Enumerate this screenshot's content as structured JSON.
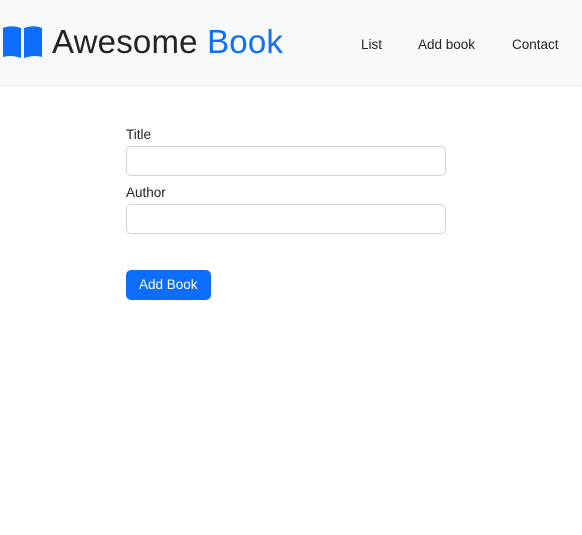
{
  "header": {
    "brand_icon": "open-book-icon",
    "brand_word1": "Awesome",
    "brand_word2": "Book",
    "nav": {
      "list_label": "List",
      "add_book_label": "Add book",
      "contact_label": "Contact"
    }
  },
  "form": {
    "title_label": "Title",
    "title_value": "",
    "author_label": "Author",
    "author_value": "",
    "submit_label": "Add Book"
  },
  "colors": {
    "accent": "#0d6efd",
    "navbar_bg": "#f8f9fa",
    "text": "#212529",
    "input_border": "#ced4da"
  }
}
